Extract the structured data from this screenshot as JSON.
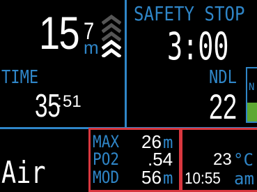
{
  "depth": {
    "whole": "15",
    "decimal": "7",
    "unit": "m",
    "ascent_icon": "ascent-rate-chevrons-icon"
  },
  "safety_stop": {
    "label": "SAFETY STOP",
    "time": "3:00"
  },
  "dive_time": {
    "label": "TIME",
    "minutes": "35",
    "seconds": "51"
  },
  "ndl": {
    "label": "NDL",
    "value": "22",
    "gauge_letter": "N",
    "gauge_level_green": 0.35
  },
  "gas": {
    "name": "Air"
  },
  "gas_info": {
    "max_label": "MAX",
    "max_value": "26",
    "max_unit": "m",
    "po2_label": "PO2",
    "po2_value": ".54",
    "mod_label": "MOD",
    "mod_value": "56",
    "mod_unit": "m"
  },
  "temp_clock": {
    "temperature": "23",
    "temp_unit": "°C",
    "time": "10:55",
    "ampm": "am"
  },
  "colors": {
    "accent": "#2f86c8",
    "text": "#ffffff",
    "highlight_box": "#d9373f",
    "ndl_bar": "#5da832"
  }
}
